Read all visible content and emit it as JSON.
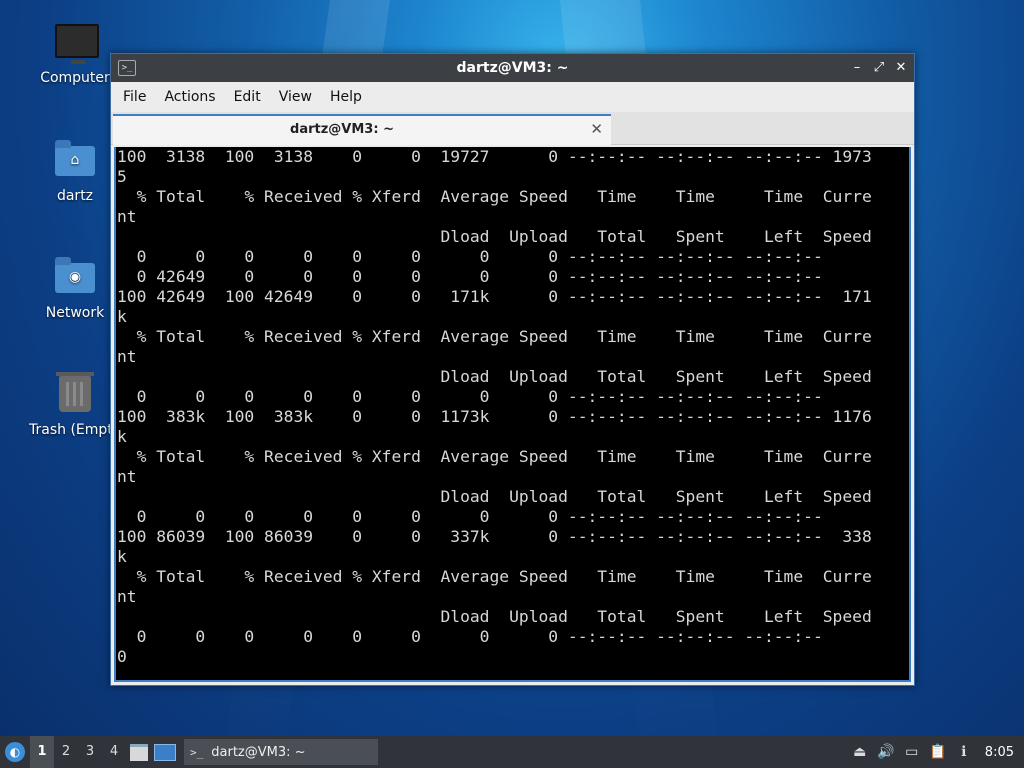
{
  "desktop": {
    "icons": [
      {
        "label": "Computer"
      },
      {
        "label": "dartz"
      },
      {
        "label": "Network"
      },
      {
        "label": "Trash (Empty)"
      }
    ]
  },
  "window": {
    "title": "dartz@VM3: ~",
    "menu": [
      "File",
      "Actions",
      "Edit",
      "View",
      "Help"
    ],
    "tab": {
      "title": "dartz@VM3: ~"
    },
    "terminal_lines": [
      "100  3138  100  3138    0     0  19727      0 --:--:-- --:--:-- --:--:-- 1973",
      "5",
      "  % Total    % Received % Xferd  Average Speed   Time    Time     Time  Curre",
      "nt",
      "                                 Dload  Upload   Total   Spent    Left  Speed",
      "  0     0    0     0    0     0      0      0 --:--:-- --:--:-- --:--:--",
      "  0 42649    0     0    0     0      0      0 --:--:-- --:--:-- --:--:--",
      "100 42649  100 42649    0     0   171k      0 --:--:-- --:--:-- --:--:--  171",
      "k",
      "  % Total    % Received % Xferd  Average Speed   Time    Time     Time  Curre",
      "nt",
      "                                 Dload  Upload   Total   Spent    Left  Speed",
      "  0     0    0     0    0     0      0      0 --:--:-- --:--:-- --:--:--",
      "100  383k  100  383k    0     0  1173k      0 --:--:-- --:--:-- --:--:-- 1176",
      "k",
      "  % Total    % Received % Xferd  Average Speed   Time    Time     Time  Curre",
      "nt",
      "                                 Dload  Upload   Total   Spent    Left  Speed",
      "  0     0    0     0    0     0      0      0 --:--:-- --:--:-- --:--:--",
      "100 86039  100 86039    0     0   337k      0 --:--:-- --:--:-- --:--:--  338",
      "k",
      "  % Total    % Received % Xferd  Average Speed   Time    Time     Time  Curre",
      "nt",
      "                                 Dload  Upload   Total   Spent    Left  Speed",
      "  0     0    0     0    0     0      0      0 --:--:-- --:--:-- --:--:--",
      "0"
    ]
  },
  "taskbar": {
    "workspaces": [
      "1",
      "2",
      "3",
      "4"
    ],
    "active_workspace": "1",
    "task_label": "dartz@VM3: ~",
    "clock": "8:05"
  }
}
